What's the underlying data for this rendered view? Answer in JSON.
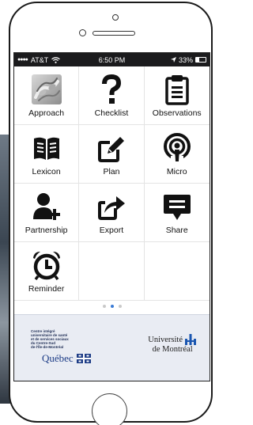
{
  "status_bar": {
    "carrier": "AT&T",
    "time": "6:50 PM",
    "battery_text": "33%",
    "battery_level": 0.33
  },
  "tiles": [
    {
      "label": "Approach",
      "icon": "approach-icon"
    },
    {
      "label": "Checklist",
      "icon": "question-mark-icon"
    },
    {
      "label": "Observations",
      "icon": "clipboard-icon"
    },
    {
      "label": "Lexicon",
      "icon": "book-icon"
    },
    {
      "label": "Plan",
      "icon": "edit-icon"
    },
    {
      "label": "Micro",
      "icon": "podcast-icon"
    },
    {
      "label": "Partnership",
      "icon": "add-user-icon"
    },
    {
      "label": "Export",
      "icon": "share-arrow-icon"
    },
    {
      "label": "Share",
      "icon": "message-icon"
    },
    {
      "label": "Reminder",
      "icon": "alarm-clock-icon"
    }
  ],
  "pager": {
    "pages": 3,
    "current": 2
  },
  "footer": {
    "left_org_lines": [
      "Centre intégré",
      "universitaire de santé",
      "et de services sociaux",
      "du Centre-Sud",
      "de-l'Île-de-Montréal"
    ],
    "left_org_name": "Québec",
    "right_org_line1": "Université",
    "right_org_line2": "de Montréal"
  },
  "colors": {
    "accent": "#3a7bd5",
    "quebec_blue": "#1d3c86",
    "montreal_blue": "#1a56b0",
    "status_bar": "#1b1b1d"
  }
}
